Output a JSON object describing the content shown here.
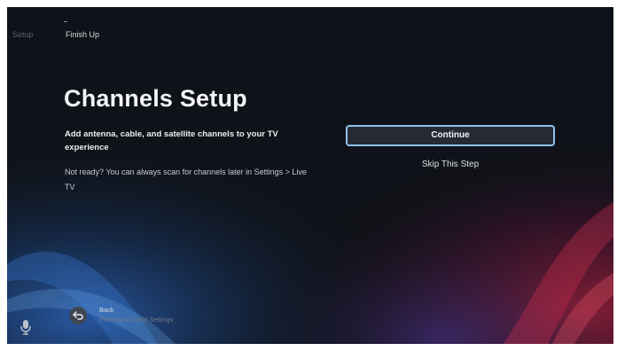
{
  "progress": {
    "previous_step": "Setup",
    "current_step": "Finish Up"
  },
  "main": {
    "title": "Channels Setup",
    "subtitle": "Add antenna, cable, and satellite channels to your TV experience",
    "note": "Not ready? You can always scan for channels later in Settings > Live TV"
  },
  "actions": {
    "continue_label": "Continue",
    "skip_label": "Skip This Step"
  },
  "back": {
    "label": "Back",
    "destination": "Parental Control Settings"
  },
  "icons": {
    "mic": "microphone-icon",
    "back": "back-arrow-icon"
  },
  "colors": {
    "focus_border": "#8fc4ea",
    "background": "#0f1218"
  }
}
